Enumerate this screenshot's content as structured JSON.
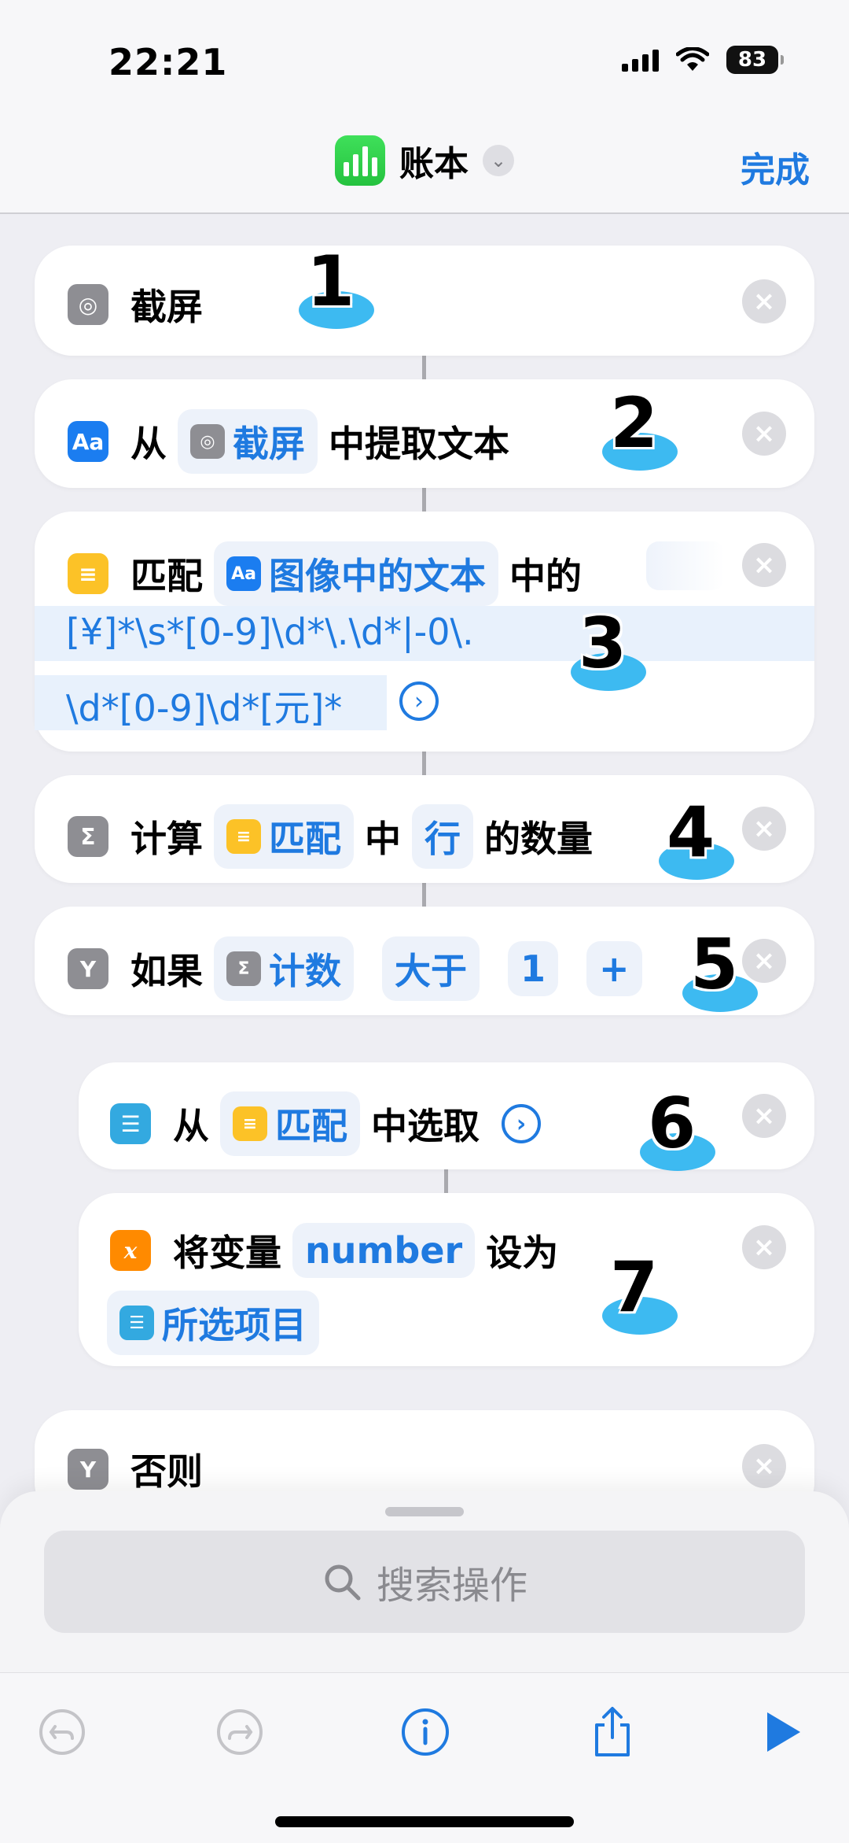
{
  "status": {
    "time": "22:21",
    "battery": "83"
  },
  "header": {
    "title": "账本",
    "done": "完成"
  },
  "actions": [
    {
      "text": "截屏"
    },
    {
      "from": "从",
      "token": "截屏",
      "rest": "中提取文本"
    },
    {
      "verb": "匹配",
      "token": "图像中的文本",
      "rest": "中的",
      "regex_line1": "[¥]*\\s*[0-9]\\d*\\.\\d*|-0\\.",
      "regex_line2": "\\d*[0-9]\\d*[元]*"
    },
    {
      "verb": "计算",
      "token": "匹配",
      "mid": "中",
      "token2": "行",
      "rest": "的数量"
    },
    {
      "verb": "如果",
      "token": "计数",
      "cond": "大于",
      "value": "1",
      "plus": "+"
    },
    {
      "from": "从",
      "token": "匹配",
      "rest": "中选取"
    },
    {
      "verb": "将变量",
      "var": "number",
      "rest": "设为",
      "token": "所选项目"
    },
    {
      "text": "否则"
    }
  ],
  "markers": [
    "1",
    "2",
    "3",
    "4",
    "5",
    "6",
    "7"
  ],
  "search": {
    "placeholder": "搜索操作"
  },
  "colors": {
    "accent": "#1f7ae0",
    "background": "#eeeef3"
  }
}
